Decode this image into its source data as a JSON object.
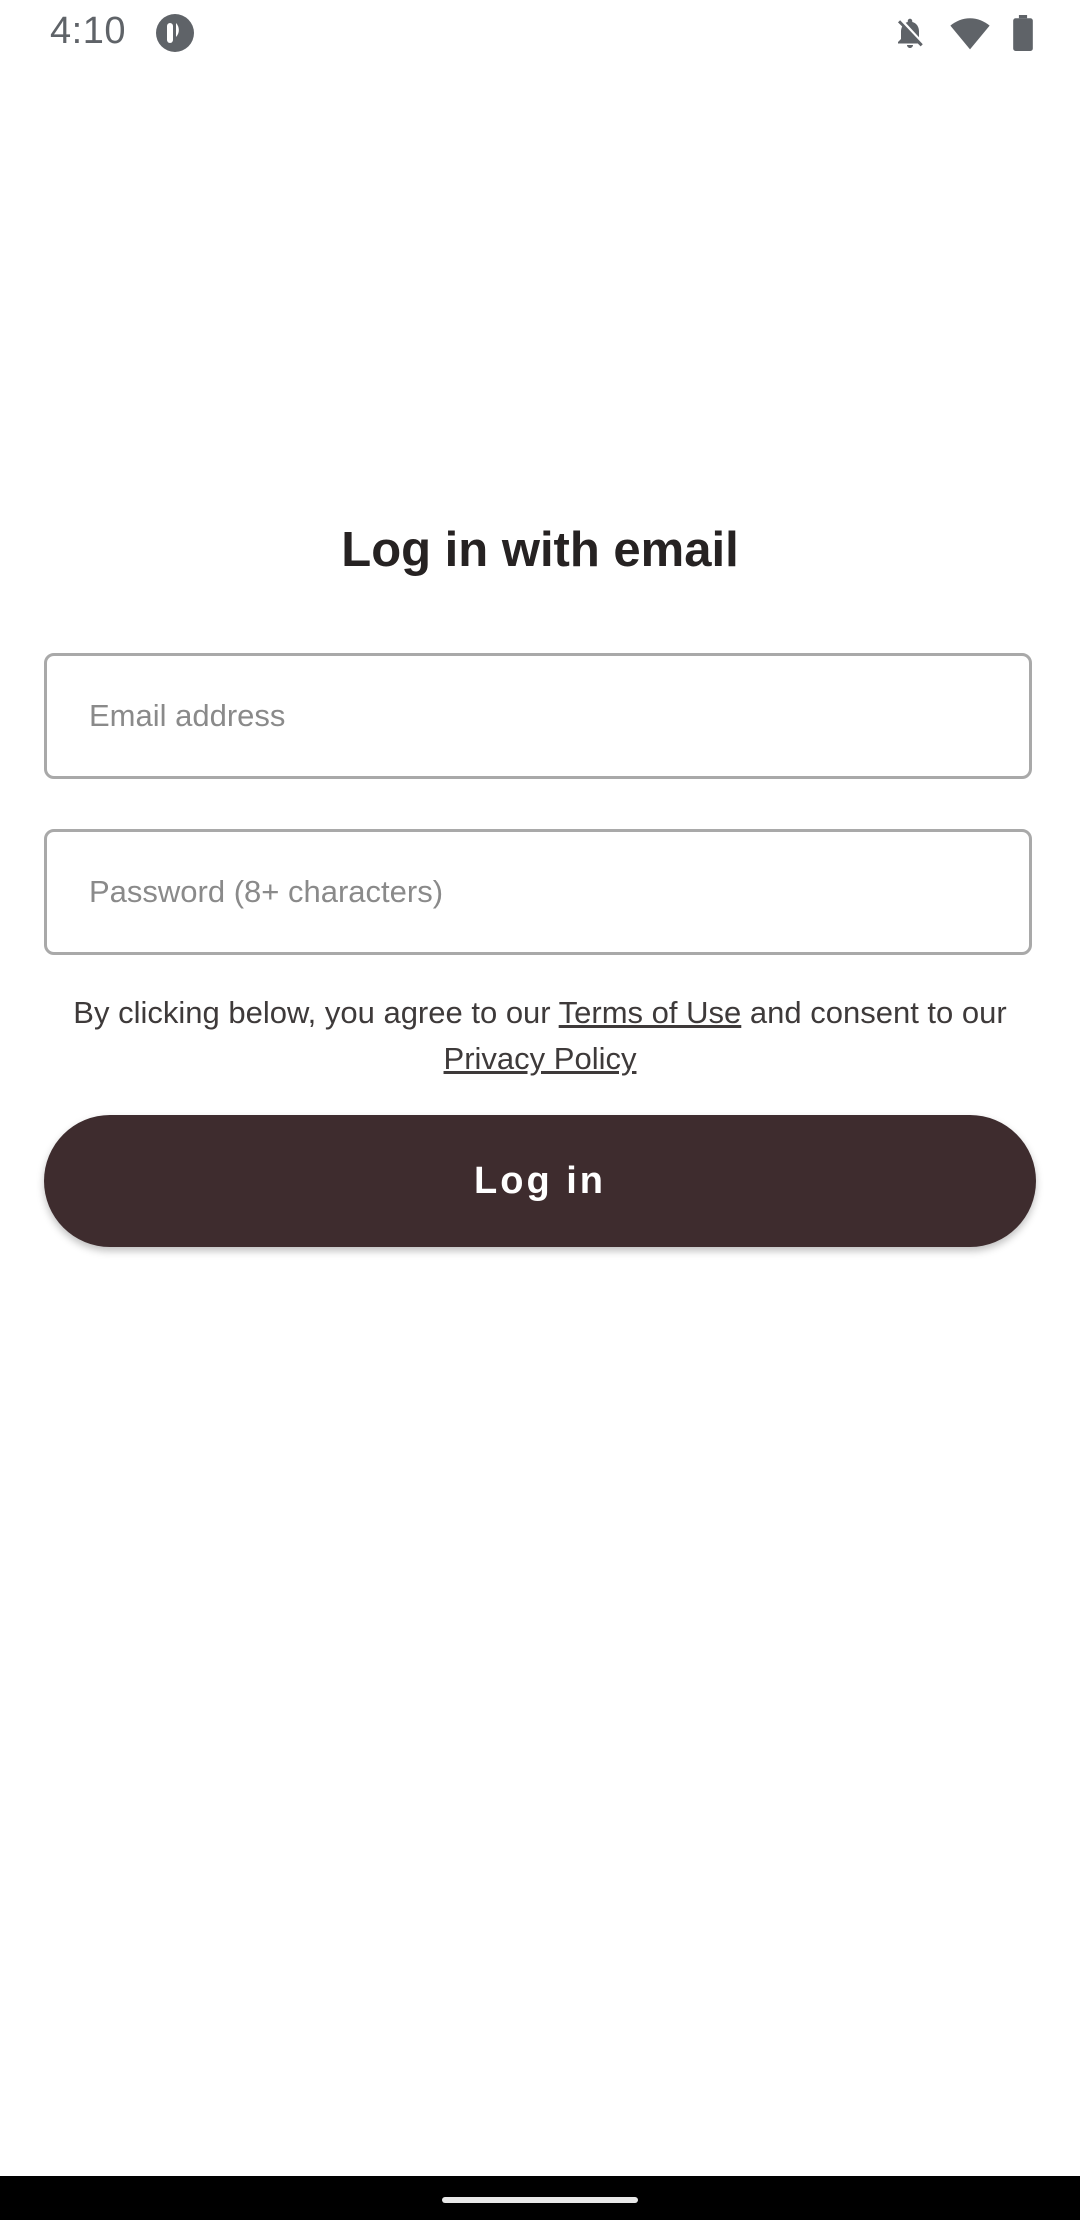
{
  "status_bar": {
    "time": "4:10",
    "icons": [
      "app-badge-icon",
      "notifications-off-icon",
      "wifi-icon",
      "battery-icon"
    ]
  },
  "login": {
    "title": "Log in with email",
    "email_placeholder": "Email address",
    "email_value": "",
    "password_placeholder": "Password (8+ characters)",
    "password_value": "",
    "legal_prefix": "By clicking below, you agree to our ",
    "terms_link": "Terms of Use",
    "legal_middle": " and consent to our ",
    "privacy_link": "Privacy Policy",
    "button_label": "Log in"
  },
  "colors": {
    "button_background": "#3e2c2e",
    "title_text": "#262222",
    "field_border": "#a9a9a9"
  }
}
